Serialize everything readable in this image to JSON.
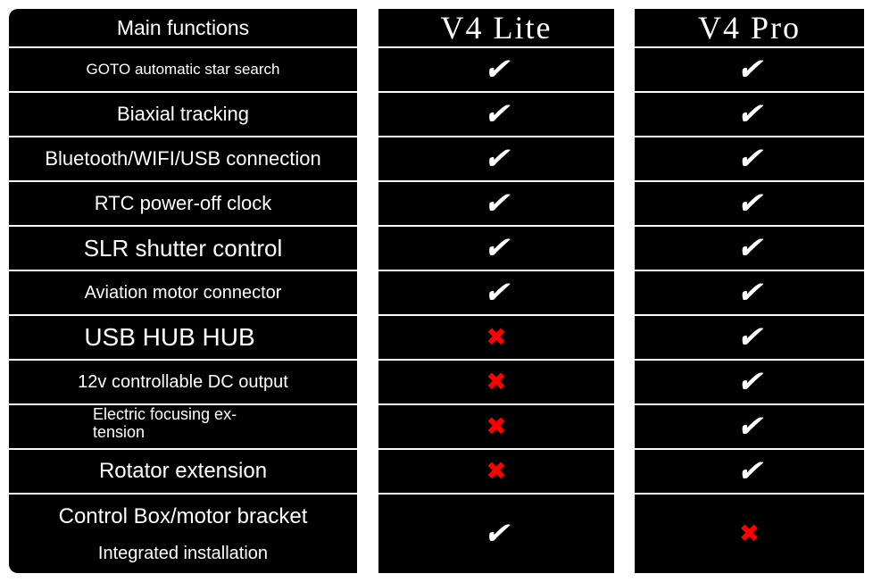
{
  "header": {
    "functions": "Main functions",
    "lite": "V4 Lite",
    "pro": "V4 Pro"
  },
  "icons": {
    "yes": "check-mark-icon",
    "no": "cross-mark-icon"
  },
  "colors": {
    "yes": "#ffffff",
    "no": "#ff0000",
    "background": "#000000"
  },
  "symbols": {
    "yes": "✔",
    "no": "✖"
  },
  "rows": [
    {
      "feature": "GOTO automatic star search",
      "lite": true,
      "pro": true
    },
    {
      "feature": "Biaxial tracking",
      "lite": true,
      "pro": true
    },
    {
      "feature": "Bluetooth/WIFI/USB connection",
      "lite": true,
      "pro": true
    },
    {
      "feature": "RTC power-off clock",
      "lite": true,
      "pro": true
    },
    {
      "feature": "SLR shutter control",
      "lite": true,
      "pro": true
    },
    {
      "feature": "Aviation motor connector",
      "lite": true,
      "pro": true
    },
    {
      "feature": "USB HUB HUB",
      "lite": false,
      "pro": true
    },
    {
      "feature": "12v controllable DC output",
      "lite": false,
      "pro": true
    },
    {
      "feature": "Electric focusing ex-",
      "feature_line2": "tension",
      "lite": false,
      "pro": true
    },
    {
      "feature": "Rotator extension",
      "lite": false,
      "pro": true
    },
    {
      "feature": "Control Box/motor bracket",
      "feature_line2": "Integrated installation",
      "lite": true,
      "pro": false
    }
  ]
}
